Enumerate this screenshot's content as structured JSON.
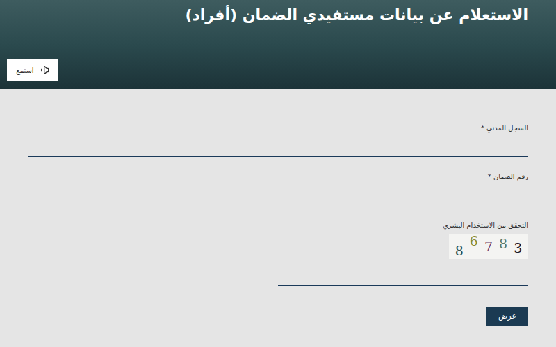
{
  "page": {
    "title": "الاستعلام عن بيانات مستفيدي الضمان (أفراد)",
    "listen_button": {
      "label": "استمع"
    }
  },
  "form": {
    "fields": [
      {
        "label": "السجل المدني *"
      },
      {
        "label": "رقم الضمان *"
      }
    ],
    "captcha": {
      "label": "التحقق من الاستخدام البشري",
      "characters": [
        {
          "char": "8",
          "color": "#2f4f4f"
        },
        {
          "char": "6",
          "color": "#8b8b2f"
        },
        {
          "char": "7",
          "color": "#6b3a6b"
        },
        {
          "char": "8",
          "color": "#5a7a6a"
        },
        {
          "char": "3",
          "color": "#1a1a2a"
        }
      ]
    },
    "submit_button": "عرض"
  }
}
